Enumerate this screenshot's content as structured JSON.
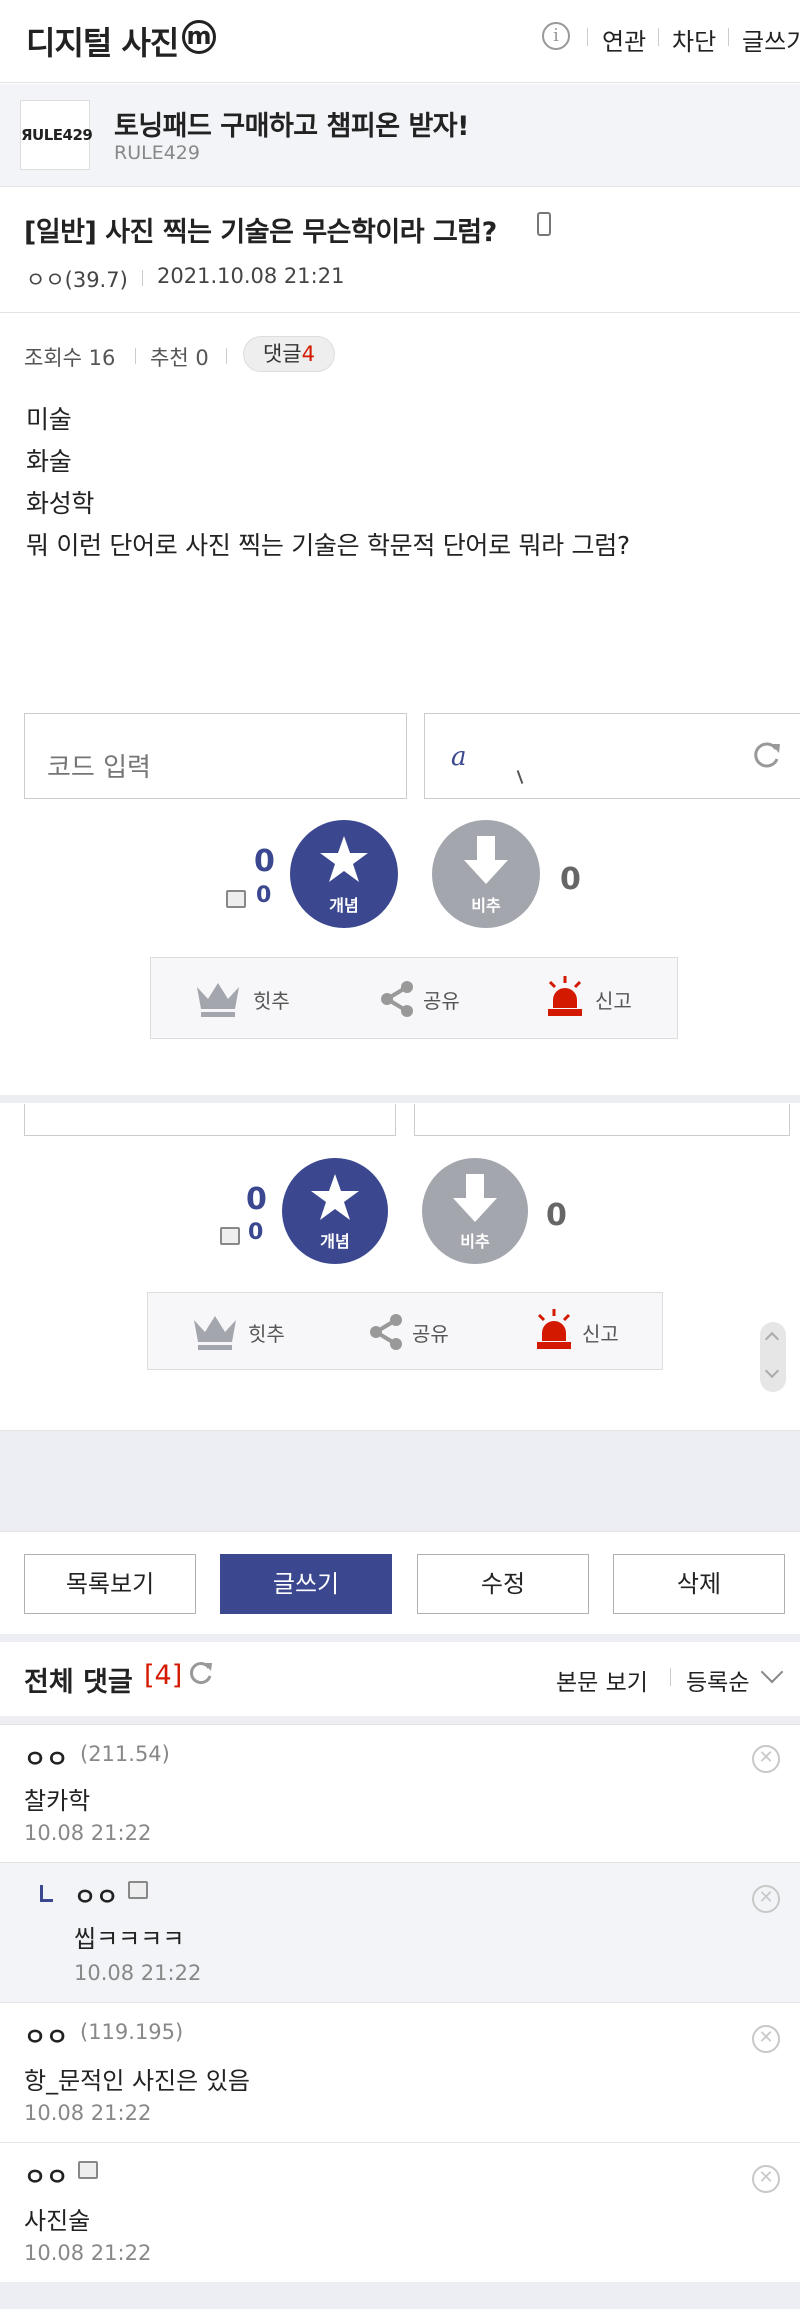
{
  "header": {
    "title": "디지털 사진",
    "badge": "m",
    "info_icon": "i",
    "links": [
      "연관",
      "차단",
      "글쓰기"
    ]
  },
  "ad": {
    "logo": "ЯULE429",
    "title": "토닝패드 구매하고 챔피온 받자!",
    "subtitle": "RULE429"
  },
  "post": {
    "title": "[일반] 사진 찍는 기술은 무슨학이라 그럼?",
    "author": "ㅇㅇ(39.7)",
    "date": "2021.10.08 21:21",
    "views": "조회수 16",
    "recommend": "추천 0",
    "comments_label": "댓글",
    "comments_count": "4",
    "body": [
      "미술",
      "화술",
      "화성학",
      "뭐 이런 단어로 사진 찍는 기술은 학문적 단어로 뭐라 그럼?"
    ]
  },
  "captcha": {
    "placeholder": "코드 입력",
    "text": "a"
  },
  "vote": {
    "up_count": "0",
    "fix_count": "0",
    "up_label": "개념",
    "down_label": "비추",
    "down_count": "0"
  },
  "actions": {
    "hit": "힛추",
    "share": "공유",
    "report": "신고"
  },
  "buttons": {
    "list": "목록보기",
    "write": "글쓰기",
    "edit": "수정",
    "delete": "삭제"
  },
  "comments_section": {
    "title": "전체 댓글",
    "count": "[4]",
    "view_body": "본문 보기",
    "sort": "등록순"
  },
  "comments": [
    {
      "name": "ㅇㅇ",
      "ip": "(211.54)",
      "text": "찰카학",
      "date": "10.08 21:22"
    },
    {
      "name": "ㅇㅇ",
      "ip": "",
      "text": "씹ㅋㅋㅋㅋ",
      "date": "10.08 21:22"
    },
    {
      "name": "ㅇㅇ",
      "ip": "(119.195)",
      "text": "항_문적인 사진은 있음",
      "date": "10.08 21:22"
    },
    {
      "name": "ㅇㅇ",
      "ip": "",
      "text": "사진술",
      "date": "10.08 21:22"
    }
  ],
  "colors": {
    "accent": "#3b4890",
    "red": "#d31900",
    "down_gray": "#a4a6ae"
  }
}
